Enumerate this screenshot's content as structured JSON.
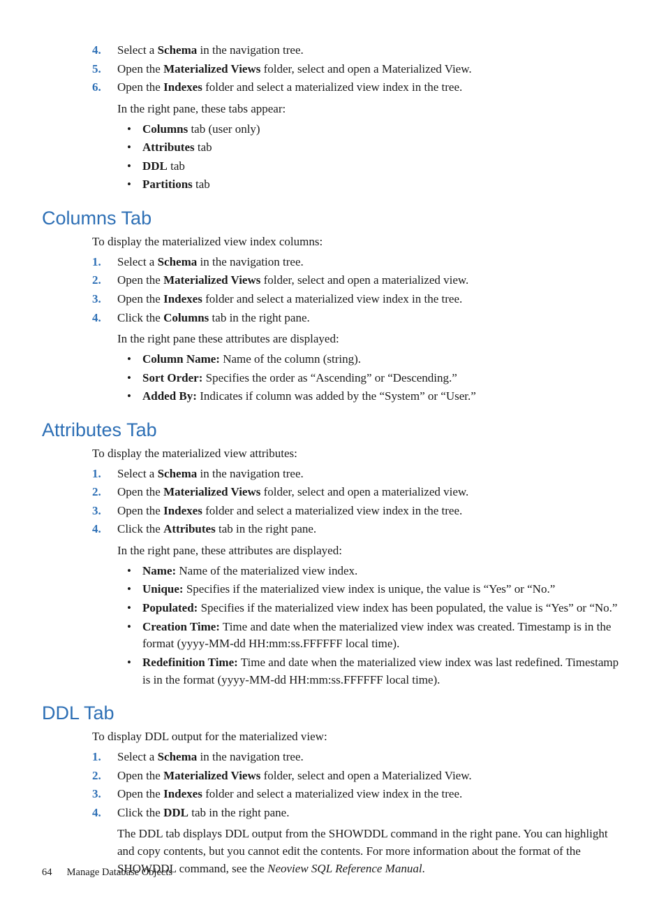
{
  "top_steps": [
    {
      "num": "4.",
      "html": "Select a <b>Schema</b> in the navigation tree."
    },
    {
      "num": "5.",
      "html": "Open the <b>Materialized Views</b> folder, select and open a Materialized View."
    },
    {
      "num": "6.",
      "html": "Open the <b>Indexes</b> folder and select a materialized view index in the tree."
    }
  ],
  "top_after": "In the right pane, these tabs appear:",
  "top_bullets": [
    "<b>Columns</b> tab (user only)",
    "<b>Attributes</b> tab",
    "<b>DDL</b> tab",
    "<b>Partitions</b> tab"
  ],
  "sections": [
    {
      "heading": "Columns Tab",
      "intro": "To display the materialized view index columns:",
      "steps": [
        {
          "num": "1.",
          "html": "Select a <b>Schema</b> in the navigation tree."
        },
        {
          "num": "2.",
          "html": "Open the <b>Materialized Views</b> folder, select and open a materialized view."
        },
        {
          "num": "3.",
          "html": "Open the <b>Indexes</b> folder and select a materialized view index in the tree."
        },
        {
          "num": "4.",
          "html": "Click the <b>Columns</b> tab in the right pane."
        }
      ],
      "after": "In the right pane these attributes are displayed:",
      "bullets": [
        "<b>Column Name:</b> Name of the column (string).",
        "<b>Sort Order:</b> Specifies the order as “Ascending” or “Descending.”",
        "<b>Added By:</b> Indicates if column was added by the “System” or “User.”"
      ]
    },
    {
      "heading": "Attributes Tab",
      "intro": "To display the materialized view attributes:",
      "steps": [
        {
          "num": "1.",
          "html": "Select a  <b>Schema</b> in the navigation tree."
        },
        {
          "num": "2.",
          "html": "Open the <b>Materialized Views</b> folder, select and open a materialized view."
        },
        {
          "num": "3.",
          "html": "Open the <b>Indexes</b> folder and select a materialized view index in the tree."
        },
        {
          "num": "4.",
          "html": "Click the <b>Attributes</b> tab in the right pane."
        }
      ],
      "after": "In the right pane, these attributes are displayed:",
      "bullets": [
        "<b>Name:</b> Name of the materialized view index.",
        "<b>Unique:</b> Specifies if the materialized view index is unique, the value is “Yes” or “No.”",
        "<b>Populated:</b> Specifies if the materialized view index has been populated, the value is “Yes” or “No.”",
        "<b>Creation Time:</b> Time and date when the materialized view index was created. Timestamp is in the format (yyyy-MM-dd HH:mm:ss.FFFFFF local time).",
        "<b>Redefinition Time:</b> Time and date when the materialized view index was last redefined. Timestamp is in the format (yyyy-MM-dd HH:mm:ss.FFFFFF local time)."
      ]
    },
    {
      "heading": "DDL Tab",
      "intro": "To display DDL output for the materialized view:",
      "steps": [
        {
          "num": "1.",
          "html": "Select a <b>Schema</b> in the navigation tree."
        },
        {
          "num": "2.",
          "html": "Open the <b>Materialized Views</b> folder, select and open a Materialized View."
        },
        {
          "num": "3.",
          "html": "Open the <b>Indexes</b> folder and select a materialized view index in the tree."
        },
        {
          "num": "4.",
          "html": "Click the <b>DDL</b> tab in the right pane."
        }
      ],
      "after_html": "The DDL tab displays DDL output from the SHOWDDL command in the right pane. You can highlight and copy contents, but you cannot edit the contents. For more information about the format of the SHOWDDL command, see the <i>Neoview SQL Reference Manual</i>.",
      "bullets": []
    }
  ],
  "footer": {
    "page": "64",
    "title": "Manage Database Objects"
  }
}
